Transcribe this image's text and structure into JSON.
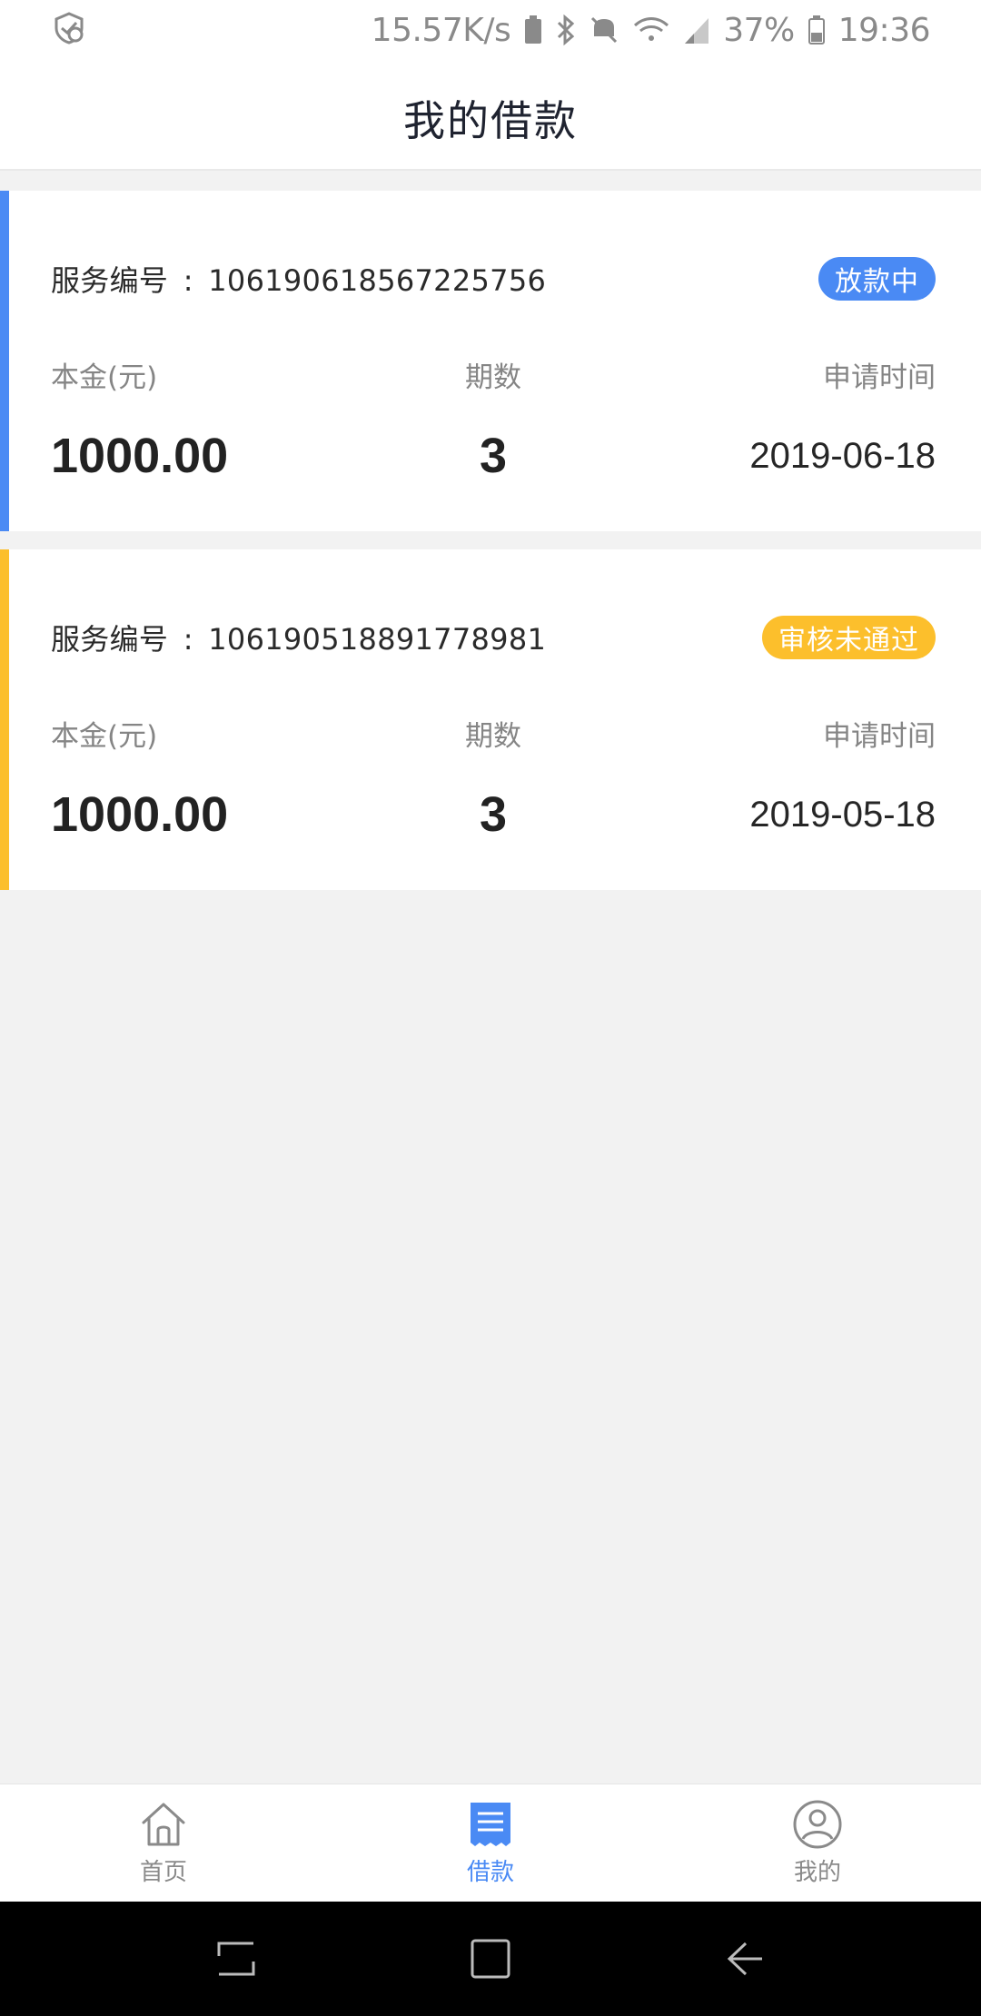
{
  "status_bar": {
    "network_speed": "15.57K/s",
    "battery": "37%",
    "time": "19:36"
  },
  "header": {
    "title": "我的借款"
  },
  "loan_labels": {
    "service_no": "服务编号",
    "separator": ":",
    "principal": "本金(元)",
    "periods": "期数",
    "apply_time": "申请时间"
  },
  "loans": [
    {
      "service_no": "106190618567225756",
      "status": "放款中",
      "status_color": "#4a8af4",
      "principal": "1000.00",
      "periods": "3",
      "apply_date": "2019-06-18"
    },
    {
      "service_no": "106190518891778981",
      "status": "审核未通过",
      "status_color": "#fcbf2c",
      "principal": "1000.00",
      "periods": "3",
      "apply_date": "2019-05-18"
    }
  ],
  "tabs": [
    {
      "label": "首页",
      "icon": "home-icon",
      "active": false
    },
    {
      "label": "借款",
      "icon": "loan-document-icon",
      "active": true
    },
    {
      "label": "我的",
      "icon": "user-profile-icon",
      "active": false
    }
  ],
  "colors": {
    "accent_blue": "#4a8af4",
    "accent_yellow": "#fcbf2c",
    "inactive_gray": "#8a8a8a"
  }
}
